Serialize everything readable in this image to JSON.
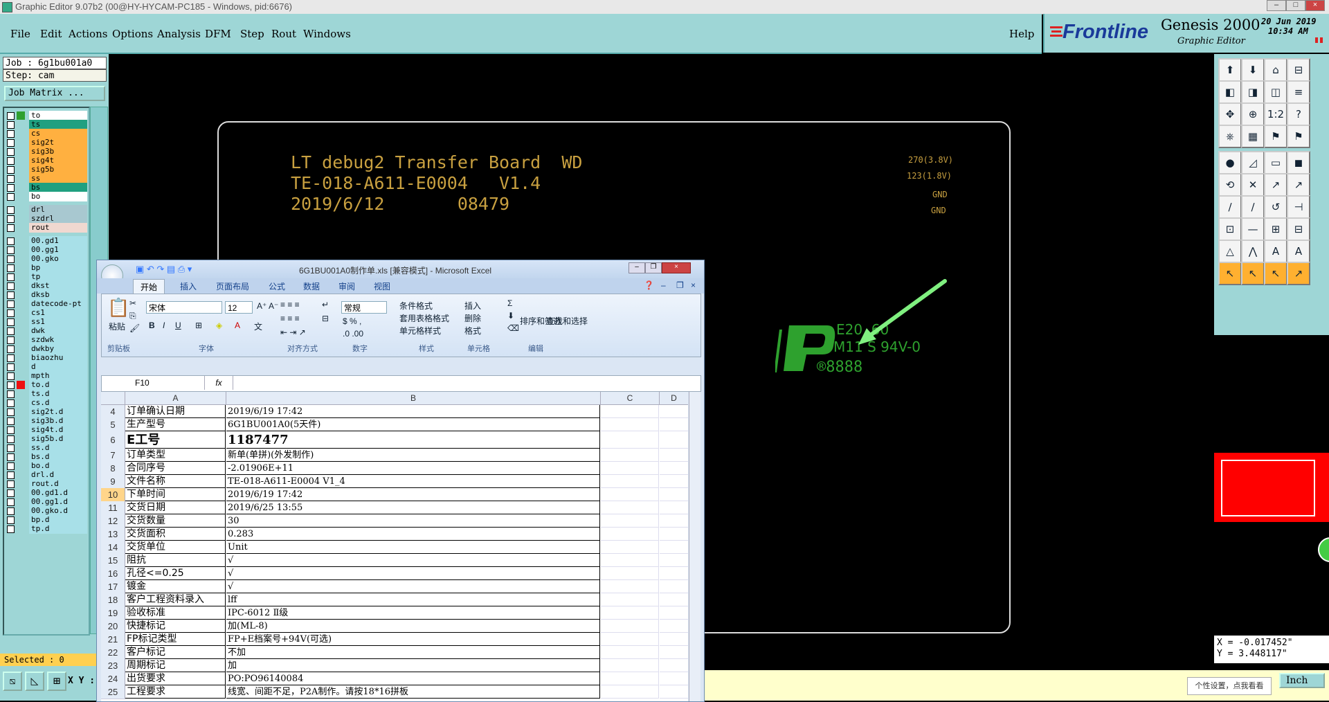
{
  "window": {
    "title": "Graphic Editor 9.07b2 (00@HY-HYCAM-PC185 - Windows, pid:6676)"
  },
  "menu": [
    "File",
    "Edit",
    "Actions",
    "Options",
    "Analysis",
    "DFM",
    "Step",
    "Rout",
    "Windows"
  ],
  "help_label": "Help",
  "brand": {
    "logo": "Frontline",
    "product": "Genesis 2000",
    "subtitle": "Graphic Editor",
    "date": "20 Jun 2019",
    "time": "10:34 AM"
  },
  "job": {
    "job_line": "Job : 6g1bu001a0",
    "step_line": "Step: cam",
    "matrix_button": "Job Matrix ..."
  },
  "layers": [
    {
      "name": "to",
      "color": "#ffffff",
      "swatch": "#30a030"
    },
    {
      "name": "ts",
      "color": "#20a080",
      "swatch": ""
    },
    {
      "name": "cs",
      "color": "#ffb040",
      "swatch": ""
    },
    {
      "name": "sig2t",
      "color": "#ffb040",
      "swatch": ""
    },
    {
      "name": "sig3b",
      "color": "#ffb040",
      "swatch": ""
    },
    {
      "name": "sig4t",
      "color": "#ffb040",
      "swatch": ""
    },
    {
      "name": "sig5b",
      "color": "#ffb040",
      "swatch": ""
    },
    {
      "name": "ss",
      "color": "#ffb040",
      "swatch": ""
    },
    {
      "name": "bs",
      "color": "#20a080",
      "swatch": ""
    },
    {
      "name": "bo",
      "color": "#ffffff",
      "swatch": ""
    },
    {
      "name": "drl",
      "color": "#a8c8d0",
      "swatch": ""
    },
    {
      "name": "szdrl",
      "color": "#a8c8d0",
      "swatch": ""
    },
    {
      "name": "rout",
      "color": "#f0d8d0",
      "swatch": ""
    },
    {
      "name": "00.gd1",
      "color": "#a8e0e8",
      "swatch": ""
    },
    {
      "name": "00.gg1",
      "color": "#a8e0e8",
      "swatch": ""
    },
    {
      "name": "00.gko",
      "color": "#a8e0e8",
      "swatch": ""
    },
    {
      "name": "bp",
      "color": "#a8e0e8",
      "swatch": ""
    },
    {
      "name": "tp",
      "color": "#a8e0e8",
      "swatch": ""
    },
    {
      "name": "dkst",
      "color": "#a8e0e8",
      "swatch": ""
    },
    {
      "name": "dksb",
      "color": "#a8e0e8",
      "swatch": ""
    },
    {
      "name": "datecode-pt",
      "color": "#a8e0e8",
      "swatch": ""
    },
    {
      "name": "cs1",
      "color": "#a8e0e8",
      "swatch": ""
    },
    {
      "name": "ss1",
      "color": "#a8e0e8",
      "swatch": ""
    },
    {
      "name": "dwk",
      "color": "#a8e0e8",
      "swatch": ""
    },
    {
      "name": "szdwk",
      "color": "#a8e0e8",
      "swatch": ""
    },
    {
      "name": "dwkby",
      "color": "#a8e0e8",
      "swatch": ""
    },
    {
      "name": "biaozhu",
      "color": "#a8e0e8",
      "swatch": ""
    },
    {
      "name": "d",
      "color": "#a8e0e8",
      "swatch": ""
    },
    {
      "name": "mpth",
      "color": "#a8e0e8",
      "swatch": ""
    },
    {
      "name": "to.d",
      "color": "#a8e0e8",
      "swatch": "#ee1010"
    },
    {
      "name": "ts.d",
      "color": "#a8e0e8",
      "swatch": ""
    },
    {
      "name": "cs.d",
      "color": "#a8e0e8",
      "swatch": ""
    },
    {
      "name": "sig2t.d",
      "color": "#a8e0e8",
      "swatch": ""
    },
    {
      "name": "sig3b.d",
      "color": "#a8e0e8",
      "swatch": ""
    },
    {
      "name": "sig4t.d",
      "color": "#a8e0e8",
      "swatch": ""
    },
    {
      "name": "sig5b.d",
      "color": "#a8e0e8",
      "swatch": ""
    },
    {
      "name": "ss.d",
      "color": "#a8e0e8",
      "swatch": ""
    },
    {
      "name": "bs.d",
      "color": "#a8e0e8",
      "swatch": ""
    },
    {
      "name": "bo.d",
      "color": "#a8e0e8",
      "swatch": ""
    },
    {
      "name": "drl.d",
      "color": "#a8e0e8",
      "swatch": ""
    },
    {
      "name": "rout.d",
      "color": "#a8e0e8",
      "swatch": ""
    },
    {
      "name": "00.gd1.d",
      "color": "#a8e0e8",
      "swatch": ""
    },
    {
      "name": "00.gg1.d",
      "color": "#a8e0e8",
      "swatch": ""
    },
    {
      "name": "00.gko.d",
      "color": "#a8e0e8",
      "swatch": ""
    },
    {
      "name": "bp.d",
      "color": "#a8e0e8",
      "swatch": ""
    },
    {
      "name": "tp.d",
      "color": "#a8e0e8",
      "swatch": ""
    }
  ],
  "selected_label": "Selected : 0",
  "xy_label": "X Y :",
  "board": {
    "line1": "LT debug2 Transfer Board  WD",
    "line2": "TE-018-A611-E0004   V1.4",
    "line3": "2019/6/12       08479",
    "note1": "270(3.8V)",
    "note2": "123(1.8V)",
    "note3": "GND",
    "note4": "GND",
    "logo_text1": "E20  60",
    "logo_text2": "M11 S 94V-0",
    "logo_text3": "®8888"
  },
  "coords": {
    "x": "X = -0.017452\"",
    "y": "Y = 3.448117\""
  },
  "unit_button": "Inch",
  "tooltip": "个性设置，点我看看",
  "excel": {
    "title": "6G1BU001A0制作单.xls [兼容模式] - Microsoft Excel",
    "tabs": [
      "开始",
      "插入",
      "页面布局",
      "公式",
      "数据",
      "审阅",
      "视图"
    ],
    "font_name": "宋体",
    "font_size": "12",
    "number_format": "常规",
    "groups": [
      "剪贴板",
      "字体",
      "对齐方式",
      "数字",
      "样式",
      "单元格",
      "编辑"
    ],
    "buttons": {
      "paste": "粘贴",
      "cond_format": "条件格式",
      "table_format": "套用表格格式",
      "cell_style": "单元格样式",
      "insert": "插入",
      "delete": "删除",
      "format": "格式",
      "sort": "排序和筛选",
      "find": "查找和选择"
    },
    "name_box": "F10",
    "fx": "fx",
    "columns": [
      "A",
      "B",
      "C",
      "D"
    ],
    "rows": [
      {
        "n": "4",
        "a": "订单确认日期",
        "b": "2019/6/19 17:42"
      },
      {
        "n": "5",
        "a": "生产型号",
        "b": "6G1BU001A0(5天件)"
      },
      {
        "n": "6",
        "a": "E工号",
        "b": "1187477"
      },
      {
        "n": "7",
        "a": "订单类型",
        "b": "新单(单拼)(外发制作)"
      },
      {
        "n": "8",
        "a": "合同序号",
        "b": "-2.01906E+11"
      },
      {
        "n": "9",
        "a": "文件名称",
        "b": "TE-018-A611-E0004 V1_4"
      },
      {
        "n": "10",
        "a": "下单时间",
        "b": "2019/6/19 17:42"
      },
      {
        "n": "11",
        "a": "交货日期",
        "b": "2019/6/25 13:55"
      },
      {
        "n": "12",
        "a": "交货数量",
        "b": "30"
      },
      {
        "n": "13",
        "a": "交货面积",
        "b": "0.283"
      },
      {
        "n": "14",
        "a": "交货单位",
        "b": "Unit"
      },
      {
        "n": "15",
        "a": "阻抗",
        "b": "√"
      },
      {
        "n": "16",
        "a": "孔径<=0.25",
        "b": "√"
      },
      {
        "n": "17",
        "a": "镀金",
        "b": "√"
      },
      {
        "n": "18",
        "a": "客户工程资料录入",
        "b": "lff"
      },
      {
        "n": "19",
        "a": "验收标准",
        "b": "IPC-6012 Ⅱ级"
      },
      {
        "n": "20",
        "a": "快捷标记",
        "b": "加(ML-8)"
      },
      {
        "n": "21",
        "a": "FP标记类型",
        "b": "FP+E档案号+94V(可选)"
      },
      {
        "n": "22",
        "a": "客户标记",
        "b": "不加"
      },
      {
        "n": "23",
        "a": "周期标记",
        "b": "加"
      },
      {
        "n": "24",
        "a": "出货要求",
        "b": "PO:PO96140084"
      },
      {
        "n": "25",
        "a": "工程要求",
        "b": "线宽、间距不足，P2A制作。请按18*16拼板"
      }
    ]
  }
}
